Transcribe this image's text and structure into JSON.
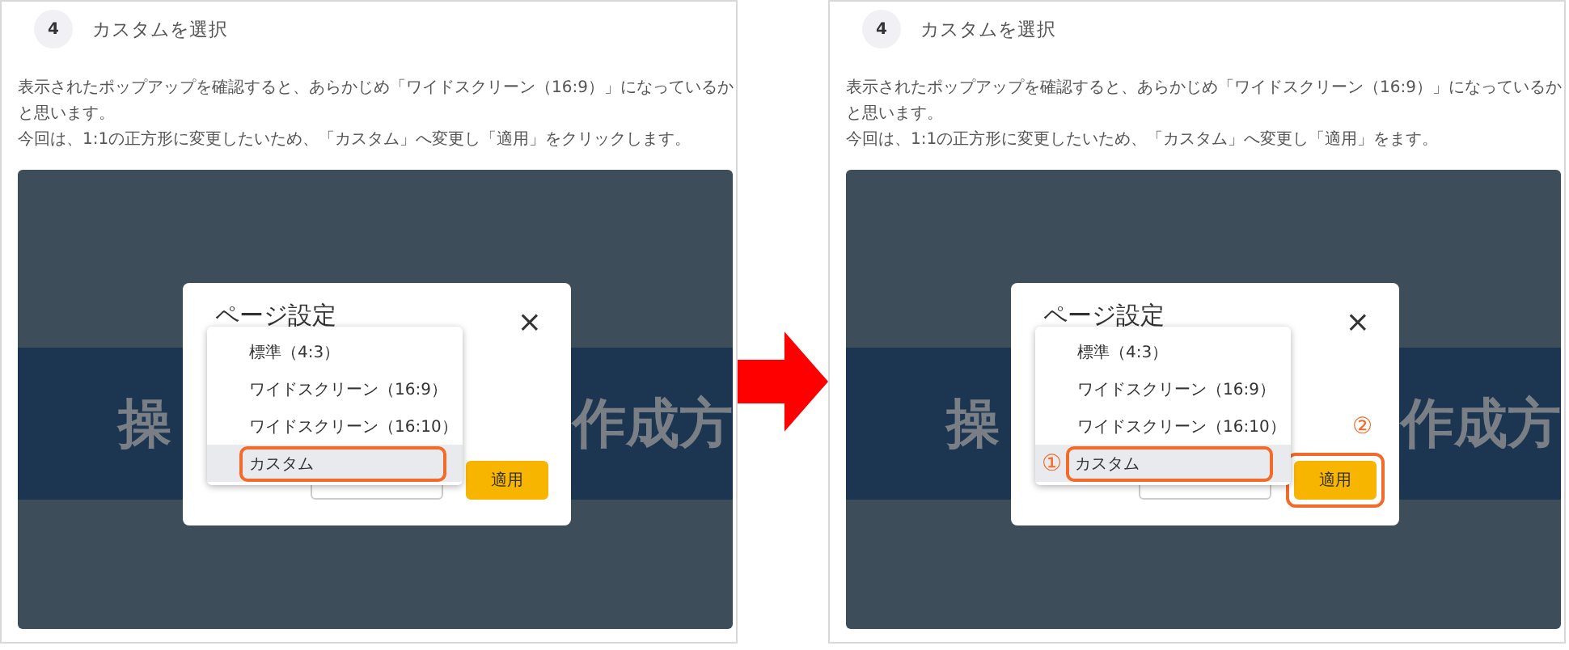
{
  "panels": [
    {
      "step": "4",
      "title": "カスタムを選択",
      "paragraphs": [
        "表示されたポップアップを確認すると、あらかじめ「ワイドスクリーン（16:9）」になっているかと思います。",
        "今回は、1:1の正方形に変更したいため、「カスタム」へ変更し「適用」をクリックします。"
      ],
      "screenshot": {
        "band_texts": [
          "操",
          "作成方"
        ],
        "dialog": {
          "title": "ページ設定",
          "close": "×",
          "options": [
            {
              "label": "標準（4:3）",
              "selected": false,
              "highlighted": false
            },
            {
              "label": "ワイドスクリーン（16:9）",
              "selected": false,
              "highlighted": false
            },
            {
              "label": "ワイドスクリーン（16:10）",
              "selected": false,
              "highlighted": false
            },
            {
              "label": "カスタム",
              "selected": true,
              "highlighted": true
            }
          ],
          "buttons": [
            {
              "kind": "secondary",
              "highlighted": false
            },
            {
              "label": "適用",
              "kind": "primary",
              "highlighted": false
            }
          ]
        }
      }
    },
    {
      "step": "4",
      "title": "カスタムを選択",
      "paragraphs": [
        "表示されたポップアップを確認すると、あらかじめ「ワイドスクリーン（16:9）」になっているかと思います。",
        "今回は、1:1の正方形に変更したいため、「カスタム」へ変更し「適用」をます。"
      ],
      "screenshot": {
        "band_texts": [
          "操",
          "作成方"
        ],
        "dialog": {
          "title": "ページ設定",
          "close": "×",
          "options": [
            {
              "label": "標準（4:3）",
              "selected": false,
              "highlighted": false
            },
            {
              "label": "ワイドスクリーン（16:9）",
              "selected": false,
              "highlighted": false
            },
            {
              "label": "ワイドスクリーン（16:10）",
              "selected": false,
              "highlighted": false
            },
            {
              "label": "カスタム",
              "selected": true,
              "highlighted": true,
              "marker": "①"
            }
          ],
          "buttons": [
            {
              "kind": "secondary",
              "highlighted": false
            },
            {
              "label": "適用",
              "kind": "primary",
              "highlighted": true,
              "marker": "②"
            }
          ]
        }
      }
    }
  ]
}
